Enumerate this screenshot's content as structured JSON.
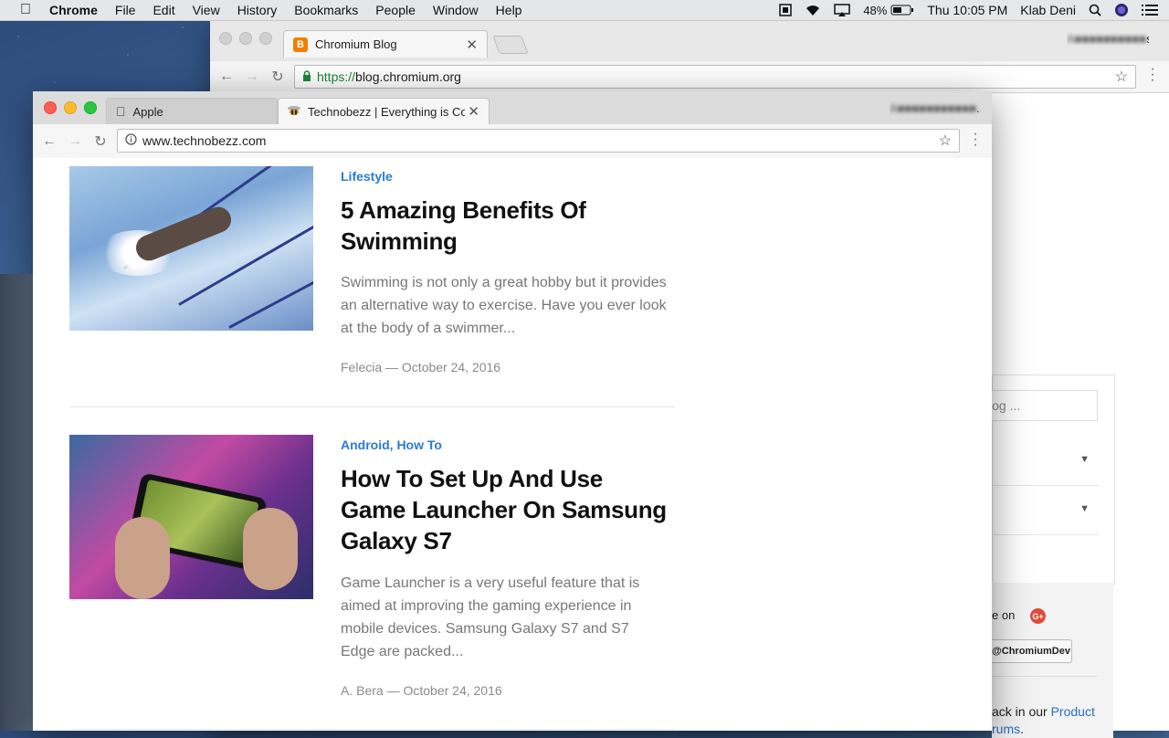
{
  "menubar": {
    "app": "Chrome",
    "items": [
      "File",
      "Edit",
      "View",
      "History",
      "Bookmarks",
      "People",
      "Window",
      "Help"
    ],
    "battery": "48%",
    "clock": "Thu 10:05 PM",
    "user": "Klab Deni"
  },
  "back_window": {
    "tab_title": "Chromium Blog",
    "url_scheme": "https://",
    "url_host": "blog.chromium.org",
    "search_placeholder": "log ...",
    "follow_on": "e on",
    "twitter_button": "@ChromiumDev",
    "feedback_prefix": "ack in our ",
    "feedback_link": "Product",
    "feedback_link2": "rums",
    "feedback_suffix": "."
  },
  "front_window": {
    "tabs": [
      {
        "title": "Apple"
      },
      {
        "title": "Technobezz | Everything is Co"
      }
    ],
    "url": "www.technobezz.com",
    "posts": [
      {
        "categories": [
          "Lifestyle"
        ],
        "title": "5 Amazing Benefits Of Swimming",
        "excerpt": "Swimming is not only a great hobby but it provides an alternative way to exercise. Have you ever look at the body of a swimmer...",
        "meta": "Felecia — October 24, 2016"
      },
      {
        "categories": [
          "Android",
          "How To"
        ],
        "title": "How To Set Up And Use Game Launcher On Samsung Galaxy S7",
        "excerpt": "Game Launcher is a very useful feature that is aimed at improving the gaming experience in mobile devices. Samsung Galaxy S7 and S7 Edge are packed...",
        "meta": "A. Bera — October 24, 2016"
      }
    ]
  },
  "icons": {
    "apple": "apple-logo-icon",
    "wifi": "wifi-icon",
    "airplay": "airplay-icon",
    "battery": "battery-icon",
    "search": "spotlight-search-icon",
    "siri": "siri-icon",
    "list": "notification-center-icon"
  }
}
